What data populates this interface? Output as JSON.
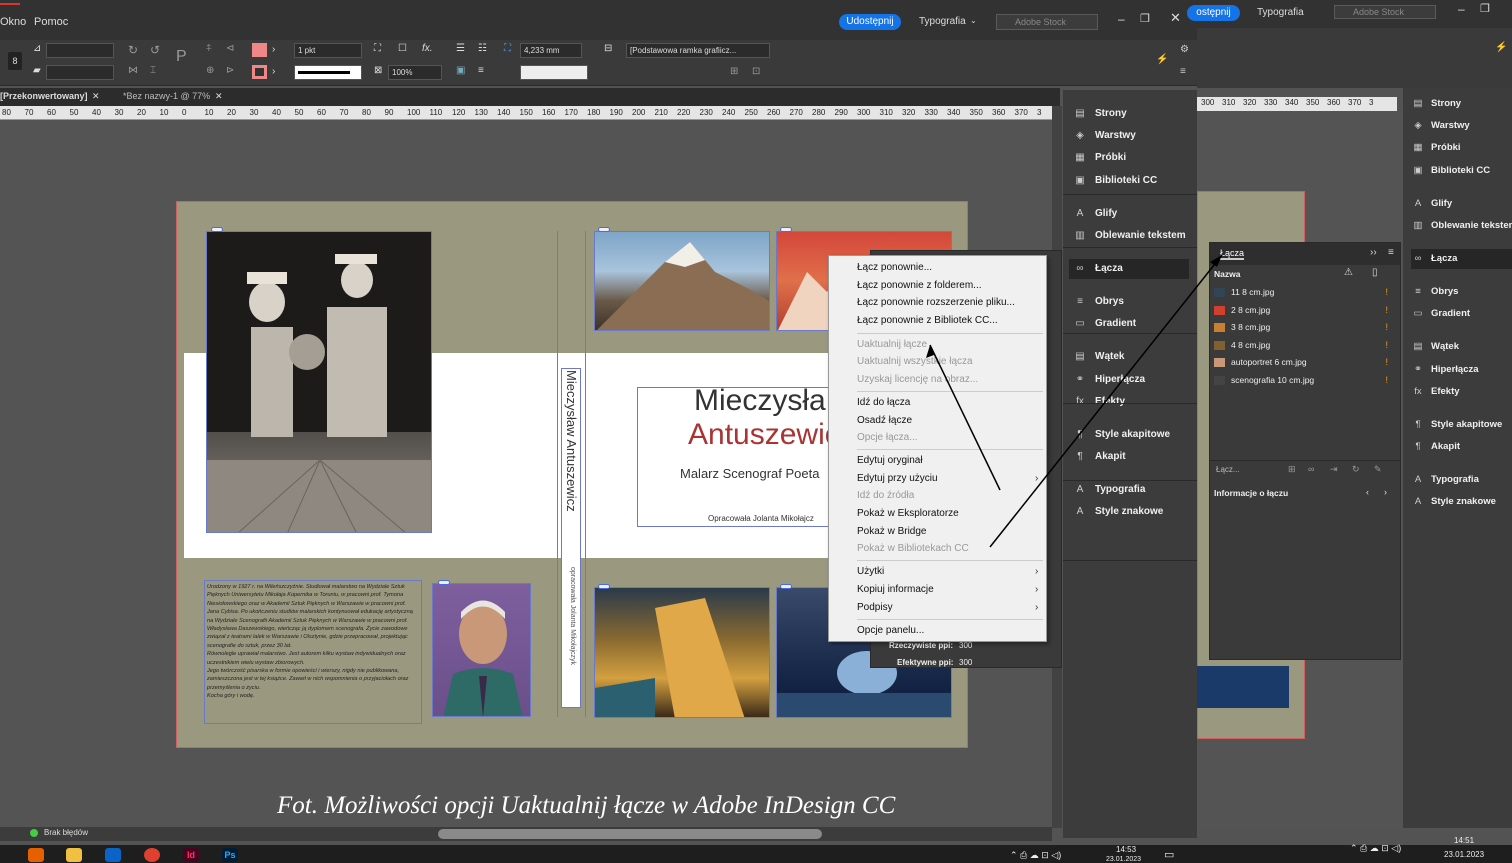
{
  "menubar": {
    "items": [
      "Okno",
      "Pomoc"
    ],
    "share": "Udostępnij",
    "typography": "Typografia",
    "search_placeholder": "Adobe Stock",
    "share2": "ostępnij",
    "typography2": "Typografia",
    "search2_placeholder": "Adobe Stock"
  },
  "control": {
    "stroke_weight": "1 pkt",
    "zoom": "100%",
    "offset": "4,233 mm",
    "frame_style": "[Podstawowa ramka grafiicz..."
  },
  "tabs": [
    "[Przekonwertowany]",
    "*Bez nazwy-1 @ 77%"
  ],
  "ruler": [
    "80",
    "70",
    "60",
    "50",
    "40",
    "30",
    "20",
    "10",
    "0",
    "10",
    "20",
    "30",
    "40",
    "50",
    "60",
    "70",
    "80",
    "90",
    "100",
    "110",
    "120",
    "130",
    "140",
    "150",
    "160",
    "170",
    "180",
    "190",
    "200",
    "210",
    "220",
    "230",
    "240",
    "250",
    "260",
    "270",
    "280",
    "290",
    "300",
    "310",
    "320",
    "330",
    "340",
    "350",
    "360",
    "370",
    "3"
  ],
  "ruler2": [
    "300",
    "310",
    "320",
    "330",
    "340",
    "350",
    "360",
    "370",
    "3"
  ],
  "document": {
    "title_line1": "Mieczysła",
    "title_line2": "Antuszewic",
    "subtitle": "Malarz Scenograf Poeta",
    "author": "Opracowała Jolanta Mikołajcz",
    "spine_name": "Mieczysław Antuszewicz",
    "spine_author": "opracowała Jolanta Mikołajczyk",
    "bio": [
      "Urodzony w 1927 r. na Wileńszczyźnie. Studiował malarstwo na Wydziale Sztuk Pięknych Uniwersytetu Mikołaja Kopernika w Toruniu, w pracowni prof. Tymona Niesiołowskiego oraz w Akademii Sztuk Pięknych w Warszawie w pracowni prof. Jana Cybisa. Po ukończeniu studiów malarskich kontynuował edukację artystyczną na Wydziale Scenografii Akademii Sztuk Pięknych w Warszawie w pracowni prof. Władysława Daszewskiego, wieńcząc ją dyplomem scenografa. Życie zawodowe związał z teatrami lalek w Warszawie i Olsztynie, gdzie przepracował, projektując scenografie do sztuk, przez 30 lat.",
      "Równolegle uprawiał malarstwo. Jest autorem kilku wystaw indywidualnych oraz uczestnikiem wielu wystaw zbiorowych.",
      "Jego twórczość pisarska w formie opowieści i wierszy, nigdy nie publikowana, zamieszczona jest w tej książce. Zawarł w nich wspomnienia o przyjaciołach oraz przemyślenia o życiu.",
      "Kocha góry i wodę."
    ]
  },
  "panels": [
    "Strony",
    "Warstwy",
    "Próbki",
    "Biblioteki CC",
    "Glify",
    "Oblewanie tekstem",
    "Łącza",
    "Obrys",
    "Gradient",
    "Wątek",
    "Hiperłącza",
    "Efekty",
    "Style akapitowe",
    "Akapit",
    "Typografia",
    "Style znakowe"
  ],
  "panel_icons": [
    "▤",
    "◈",
    "▦",
    "▣",
    "A",
    "▥",
    "∞",
    "≡",
    "▭",
    "▤",
    "⚭",
    "fx",
    "¶",
    "¶",
    "A",
    "A"
  ],
  "panels_overlap": {
    "hiper": "Hiperł",
    "efekty": "Efekty"
  },
  "links_panel": {
    "title": "Łącza",
    "col_name": "Nazwa",
    "files": [
      "11 8 cm.jpg",
      "2 8 cm.jpg",
      "3 8 cm.jpg",
      "4 8 cm.jpg",
      "autoportret 6 cm.jpg",
      "scenografia 10 cm.jpg"
    ],
    "warn": "!",
    "count_label": "Łącz...",
    "info": "Informacje o łączu"
  },
  "behind_panel": {
    "ppi": "Rzeczywiste ppi:",
    "ppi_val": "300",
    "eff_ppi": "Efektywne ppi:",
    "eff_ppi_val": "300"
  },
  "context_menu": [
    {
      "label": "Łącz ponownie...",
      "disabled": false
    },
    {
      "label": "Łącz ponownie z folderem...",
      "disabled": false
    },
    {
      "label": "Łącz ponownie rozszerzenie pliku...",
      "disabled": false
    },
    {
      "label": "Łącz ponownie z Bibliotek CC...",
      "disabled": false
    },
    {
      "label": "Uaktualnij łącze",
      "disabled": true
    },
    {
      "label": "Uaktualnij wszystkie łącza",
      "disabled": true
    },
    {
      "label": "Uzyskaj licencję na obraz...",
      "disabled": true
    },
    {
      "label": "Idź do łącza",
      "disabled": false
    },
    {
      "label": "Osadź łącze",
      "disabled": false
    },
    {
      "label": "Opcje łącza...",
      "disabled": true
    },
    {
      "label": "Edytuj oryginał",
      "disabled": false
    },
    {
      "label": "Edytuj przy użyciu",
      "disabled": false,
      "submenu": true
    },
    {
      "label": "Idź do źródła",
      "disabled": true
    },
    {
      "label": "Pokaż w Eksploratorze",
      "disabled": false
    },
    {
      "label": "Pokaż w Bridge",
      "disabled": false
    },
    {
      "label": "Pokaż w Bibliotekach CC",
      "disabled": true
    },
    {
      "label": "Użytki",
      "disabled": false,
      "submenu": true
    },
    {
      "label": "Kopiuj informacje",
      "disabled": false,
      "submenu": true
    },
    {
      "label": "Podpisy",
      "disabled": false,
      "submenu": true
    },
    {
      "label": "Opcje panelu...",
      "disabled": false
    }
  ],
  "status": {
    "errors": "Brak błędów"
  },
  "caption": "Fot. Możliwości opcji Uaktualnij łącze w Adobe InDesign CC",
  "taskbar": {
    "time1": "14:53",
    "date1": "23.01.2023",
    "time2": "14:51",
    "date2": "23.01.2023",
    "apps": [
      "Id",
      "Ps"
    ]
  },
  "colors": {
    "accent": "#1473e6",
    "warning": "#e8a020",
    "indesign": "#ff3366",
    "photoshop": "#31a8ff"
  }
}
